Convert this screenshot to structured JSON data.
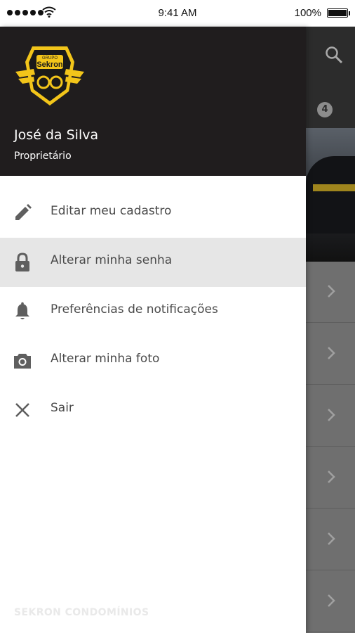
{
  "status_bar": {
    "time": "9:41 AM",
    "battery": "100%"
  },
  "background": {
    "badge_count": "4"
  },
  "user": {
    "name": "José da Silva",
    "role": "Proprietário"
  },
  "logo": {
    "line1": "GRUPO",
    "line2": "Sekron"
  },
  "menu": [
    {
      "label": "Editar meu cadastro",
      "icon": "pencil-icon",
      "active": false
    },
    {
      "label": "Alterar minha senha",
      "icon": "lock-icon",
      "active": true
    },
    {
      "label": "Preferências de notificações",
      "icon": "bell-icon",
      "active": false
    },
    {
      "label": "Alterar minha foto",
      "icon": "camera-icon",
      "active": false
    },
    {
      "label": "Sair",
      "icon": "close-icon",
      "active": false
    }
  ],
  "footer": {
    "brand": "SEKRON CONDOMÍNIOS"
  },
  "colors": {
    "header_bg": "#201d1e",
    "logo_yellow": "#f2c51a",
    "active_row": "#e6e6e6",
    "icon_gray": "#5f5f5f"
  }
}
